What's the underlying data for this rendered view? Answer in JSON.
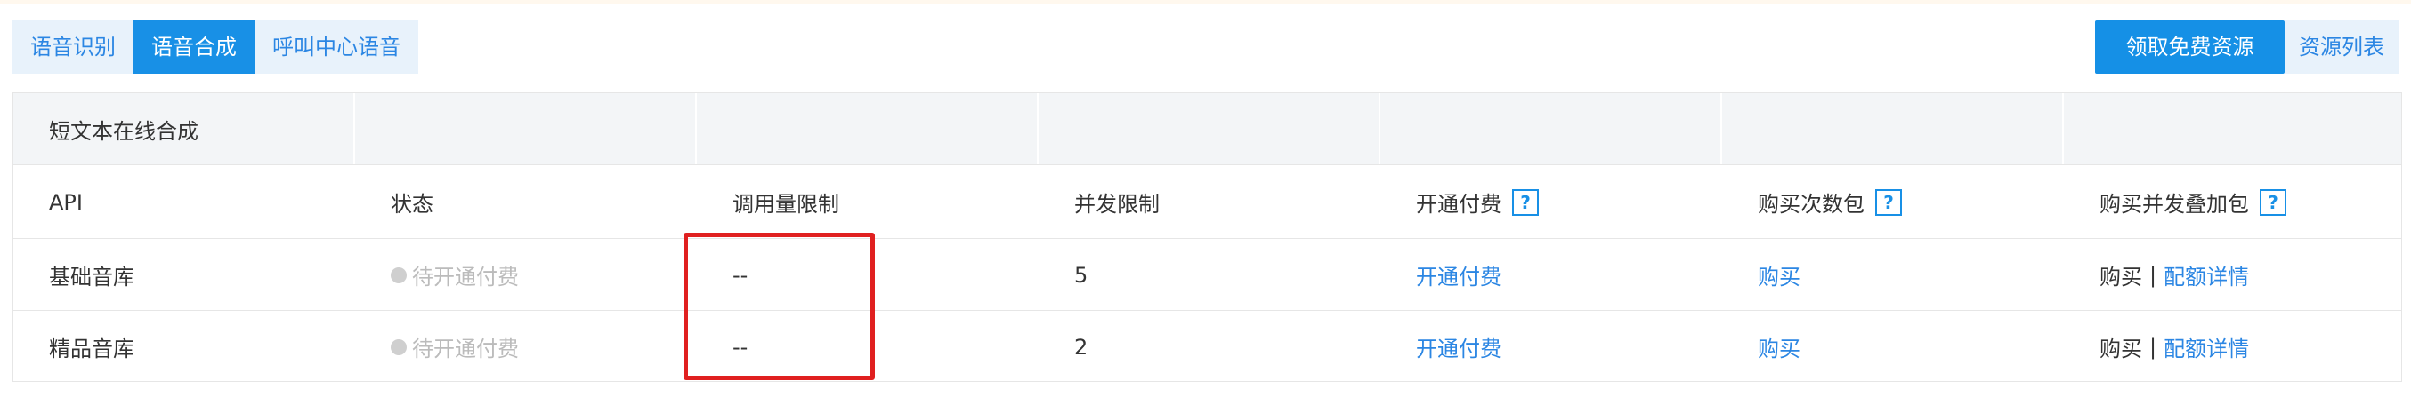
{
  "tabs": [
    {
      "label": "语音识别",
      "active": false
    },
    {
      "label": "语音合成",
      "active": true
    },
    {
      "label": "呼叫中心语音",
      "active": false
    }
  ],
  "actions": {
    "free_resources": "领取免费资源",
    "resource_list": "资源列表"
  },
  "table": {
    "group_title": "短文本在线合成",
    "headers": [
      "API",
      "状态",
      "调用量限制",
      "并发限制",
      "开通付费",
      "购买次数包",
      "购买并发叠加包"
    ],
    "help_icon": "?",
    "rows": [
      {
        "api": "基础音库",
        "status": "待开通付费",
        "call_limit": "--",
        "concurrency": "5",
        "enable_pay": "开通付费",
        "buy_pack": "购买",
        "buy_label": "购买",
        "separator": "|",
        "quota_detail": "配额详情"
      },
      {
        "api": "精品音库",
        "status": "待开通付费",
        "call_limit": "--",
        "concurrency": "2",
        "enable_pay": "开通付费",
        "buy_pack": "购买",
        "buy_label": "购买",
        "separator": "|",
        "quota_detail": "配额详情"
      }
    ]
  },
  "colors": {
    "primary": "#1890e6",
    "link": "#2b86e3",
    "tab_bg": "#e8f2fb",
    "highlight": "#e02020",
    "status_gray": "#bbbbbb"
  }
}
